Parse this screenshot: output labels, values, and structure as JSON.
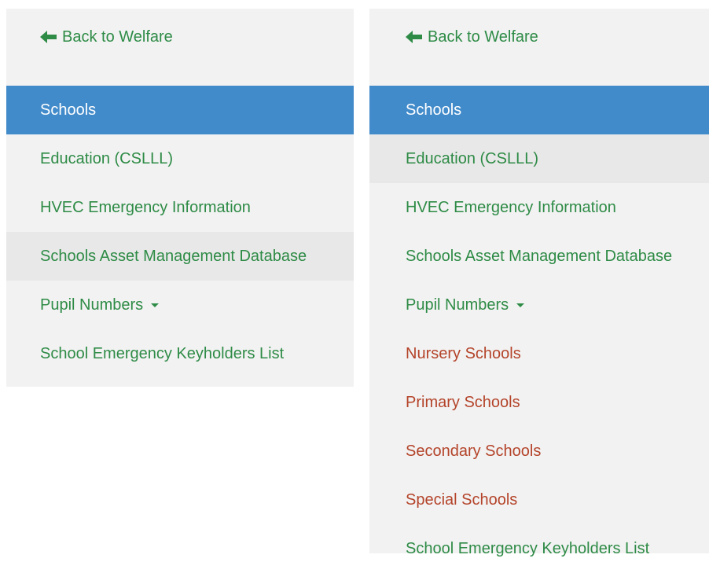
{
  "colors": {
    "accent": "#2e8b46",
    "active_bg": "#428bca",
    "sub_item": "#b4442a",
    "panel_bg": "#f2f2f2",
    "hover_bg": "#e8e8e8"
  },
  "left_panel": {
    "back_label": "Back to Welfare",
    "back_icon": "arrow-left-icon",
    "items": [
      {
        "label": "Schools"
      },
      {
        "label": "Education (CSLLL)"
      },
      {
        "label": "HVEC Emergency Information"
      },
      {
        "label": "Schools Asset Management Database"
      },
      {
        "label": "Pupil Numbers"
      },
      {
        "label": "School Emergency Keyholders List"
      }
    ]
  },
  "right_panel": {
    "back_label": "Back to Welfare",
    "back_icon": "arrow-left-icon",
    "items": [
      {
        "label": "Schools"
      },
      {
        "label": "Education (CSLLL)"
      },
      {
        "label": "HVEC Emergency Information"
      },
      {
        "label": "Schools Asset Management Database"
      },
      {
        "label": "Pupil Numbers"
      },
      {
        "label": "Nursery Schools"
      },
      {
        "label": "Primary Schools"
      },
      {
        "label": "Secondary Schools"
      },
      {
        "label": "Special Schools"
      },
      {
        "label": "School Emergency Keyholders List"
      }
    ]
  }
}
